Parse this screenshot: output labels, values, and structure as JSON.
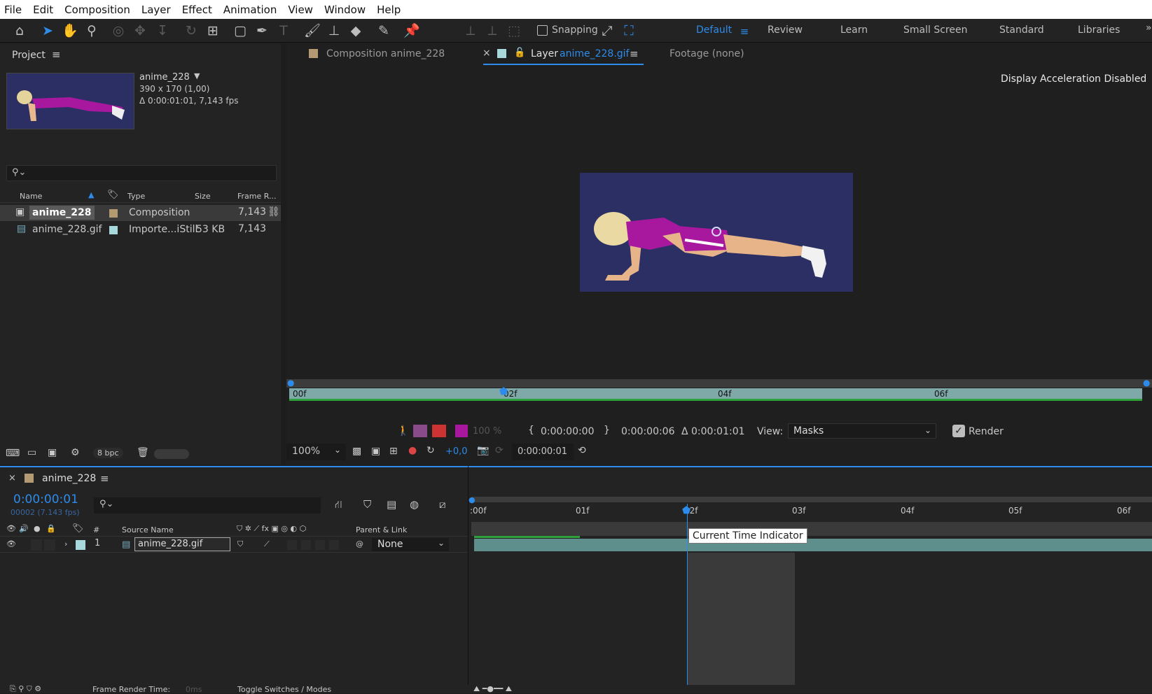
{
  "menu": [
    "File",
    "Edit",
    "Composition",
    "Layer",
    "Effect",
    "Animation",
    "View",
    "Window",
    "Help"
  ],
  "toolbar": {
    "snapping_label": "Snapping",
    "workspaces": [
      "Default",
      "Review",
      "Learn",
      "Small Screen",
      "Standard",
      "Libraries"
    ],
    "active_workspace": "Default"
  },
  "project": {
    "title": "Project",
    "item_name": "anime_228",
    "item_dims": "390 x 170 (1,00)",
    "item_duration": "Δ 0:00:01:01, 7,143 fps",
    "columns": [
      "Name",
      "Type",
      "Size",
      "Frame R..."
    ],
    "rows": [
      {
        "name": "anime_228",
        "type": "Composition",
        "size": "",
        "rate": "7,143",
        "label_color": "#b39a72"
      },
      {
        "name": "anime_228.gif",
        "type": "Importe...iStill",
        "size": "53 KB",
        "rate": "7,143",
        "label_color": "#a8d8dc"
      }
    ],
    "bpc": "8 bpc"
  },
  "viewer": {
    "tab_comp": "Composition anime_228",
    "tab_layer_prefix": "Layer",
    "tab_layer_name": "anime_228.gif",
    "tab_footage": "Footage  (none)",
    "notice": "Display Acceleration Disabled",
    "ruler_labels": [
      "00f",
      "02f",
      "04f",
      "06f"
    ],
    "in_time": "0:00:00:00",
    "out_time": "0:00:00:06",
    "duration": "Δ 0:00:01:01",
    "view_label": "View:",
    "view_value": "Masks",
    "render_label": "Render",
    "opacity": "100 %",
    "zoom": "100%",
    "exposure": "+0,0",
    "current_time": "0:00:00:01"
  },
  "timeline": {
    "comp_name": "anime_228",
    "timecode": "0:00:00:01",
    "frames_info": "00002 (7.143 fps)",
    "col_num": "#",
    "col_source": "Source Name",
    "col_parent": "Parent & Link",
    "ruler_labels": [
      ":00f",
      "01f",
      "02f",
      "03f",
      "04f",
      "05f",
      "06f"
    ],
    "layer": {
      "index": "1",
      "name": "anime_228.gif",
      "parent": "None"
    },
    "tooltip": "Current Time Indicator",
    "bottom_left": "Frame Render Time:",
    "bottom_left_value": "0ms",
    "bottom_center": "Toggle Switches / Modes"
  },
  "colors": {
    "accent": "#2d8ceb",
    "comp_bg": "#2b2f63",
    "layer_bar": "#5f8f8c"
  }
}
